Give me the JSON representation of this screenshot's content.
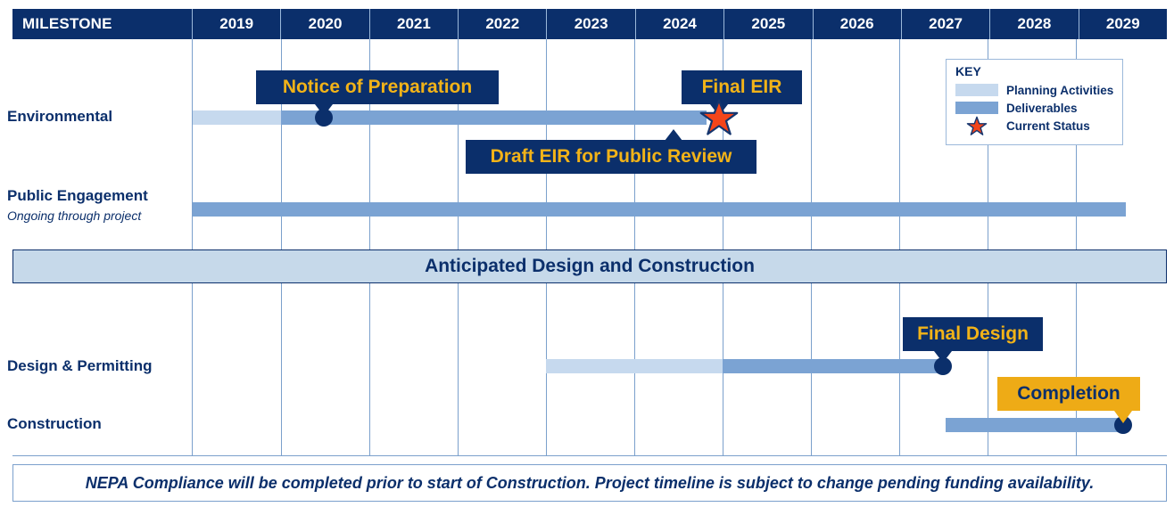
{
  "header": {
    "milestone_label": "MILESTONE",
    "years": [
      "2019",
      "2020",
      "2021",
      "2022",
      "2023",
      "2024",
      "2025",
      "2026",
      "2027",
      "2028",
      "2029"
    ]
  },
  "rows": {
    "environmental": {
      "label": "Environmental",
      "bar_light_span": "2019",
      "bar_medium_span": "2020-2024",
      "callouts": {
        "notice_of_preparation": "Notice of Preparation",
        "final_eir": "Final EIR",
        "draft_eir": "Draft EIR for Public Review"
      }
    },
    "public_engagement": {
      "label": "Public Engagement",
      "sublabel": "Ongoing through project",
      "bar_medium_span": "2019-2029"
    },
    "design_permitting": {
      "label": "Design & Permitting",
      "bar_light_span": "2023-2025",
      "bar_medium_span": "2025-2027",
      "callout": "Final Design"
    },
    "construction": {
      "label": "Construction",
      "bar_medium_span": "2027-2029",
      "callout": "Completion"
    }
  },
  "section_banner": {
    "label": "Anticipated Design and Construction"
  },
  "key": {
    "title": "KEY",
    "items": [
      {
        "label": "Planning Activities",
        "swatch": "light-blue-swatch",
        "color": "#c6d9ee"
      },
      {
        "label": "Deliverables",
        "swatch": "medium-blue-swatch",
        "color": "#7ba3d3"
      },
      {
        "label": "Current Status",
        "swatch": "star-icon",
        "color": "#f4451a"
      }
    ]
  },
  "footer": {
    "note": "NEPA Compliance will be completed prior to start of Construction. Project timeline is subject to change pending funding availability."
  },
  "colors": {
    "navy": "#0b2f6b",
    "gold": "#eeab16",
    "gold_text": "#f2b318",
    "light_blue": "#c6d9ee",
    "medium_blue": "#7ba3d3",
    "banner_blue": "#c6d9ea",
    "star_red": "#f4451a",
    "gridline": "#7ba0cc"
  },
  "chart_data": {
    "type": "bar",
    "title": "Project Milestone Timeline",
    "xlabel": "",
    "ylabel": "MILESTONE",
    "x": [
      "2019",
      "2020",
      "2021",
      "2022",
      "2023",
      "2024",
      "2025",
      "2026",
      "2027",
      "2028",
      "2029"
    ],
    "xlim": [
      2019,
      2030
    ],
    "grid": true,
    "legend": "top-right",
    "categories": [
      "Environmental",
      "Public Engagement",
      "Design & Permitting",
      "Construction"
    ],
    "series": [
      {
        "name": "Planning Activities",
        "color": "#c6d9ee",
        "bars": [
          {
            "category": "Environmental",
            "start": 2019,
            "end": 2020
          },
          {
            "category": "Design & Permitting",
            "start": 2023,
            "end": 2025
          }
        ]
      },
      {
        "name": "Deliverables",
        "color": "#7ba3d3",
        "bars": [
          {
            "category": "Environmental",
            "start": 2020,
            "end": 2024.8
          },
          {
            "category": "Public Engagement",
            "start": 2019,
            "end": 2029.6
          },
          {
            "category": "Design & Permitting",
            "start": 2025,
            "end": 2027.5
          },
          {
            "category": "Construction",
            "start": 2027.5,
            "end": 2029.5
          }
        ]
      }
    ],
    "milestones": [
      {
        "label": "Notice of Preparation",
        "category": "Environmental",
        "at": 2020.5,
        "marker": "dot"
      },
      {
        "label": "Final EIR",
        "category": "Environmental",
        "at": 2024.9,
        "marker": "star"
      },
      {
        "label": "Draft EIR for Public Review",
        "category": "Environmental",
        "at": 2024.4,
        "marker": "pointer-up"
      },
      {
        "label": "Final Design",
        "category": "Design & Permitting",
        "at": 2027.5,
        "marker": "dot"
      },
      {
        "label": "Completion",
        "category": "Construction",
        "at": 2029.5,
        "marker": "dot"
      }
    ],
    "annotations": [
      "Anticipated Design and Construction",
      "NEPA Compliance will be completed prior to start of Construction. Project timeline is subject to change pending funding availability."
    ]
  }
}
